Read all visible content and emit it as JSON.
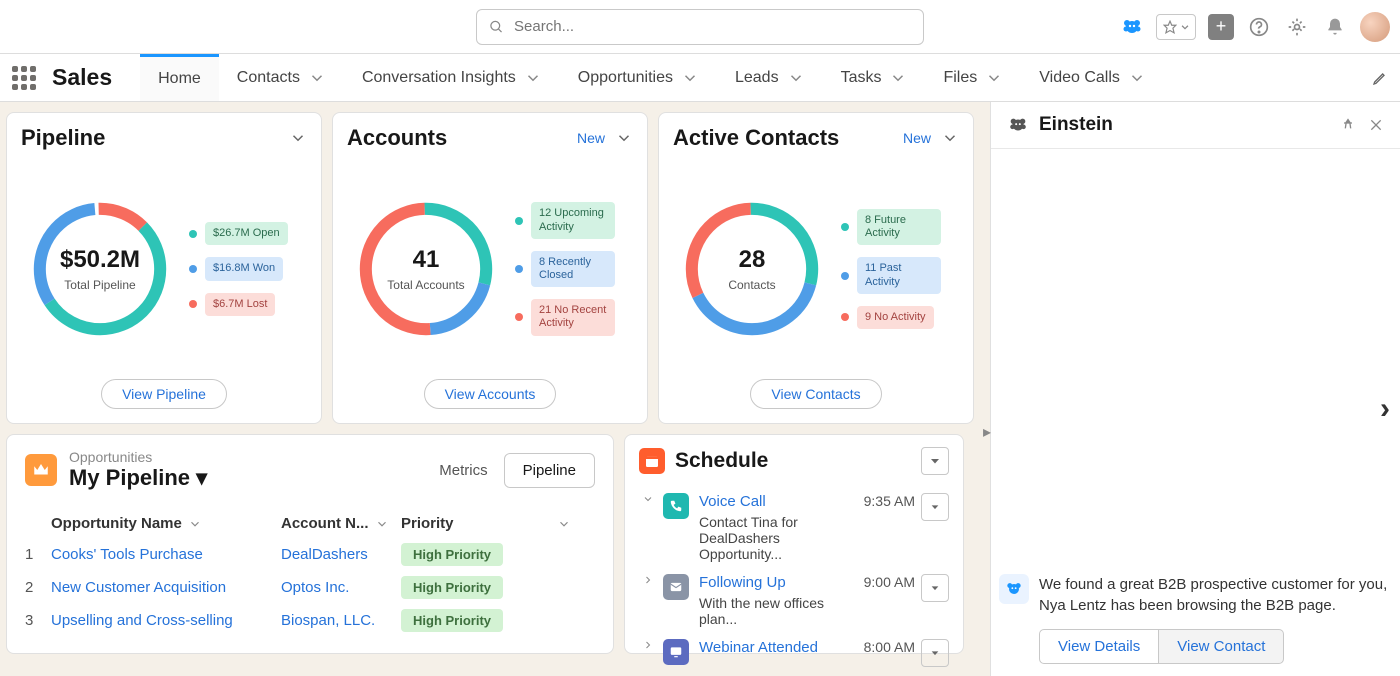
{
  "header": {
    "search_placeholder": "Search...",
    "app_title": "Sales"
  },
  "tabs": [
    "Home",
    "Contacts",
    "Conversation Insights",
    "Opportunities",
    "Leads",
    "Tasks",
    "Files",
    "Video Calls"
  ],
  "pipeline_card": {
    "title": "Pipeline",
    "center_value": "$50.2M",
    "center_label": "Total Pipeline",
    "legend": [
      {
        "text": "$26.7M Open",
        "color": "#2ec4b6"
      },
      {
        "text": "$16.8M Won",
        "color": "#4f9de7"
      },
      {
        "text": "$6.7M Lost",
        "color": "#f76c5e"
      }
    ],
    "view_btn": "View Pipeline"
  },
  "accounts_card": {
    "title": "Accounts",
    "action": "New",
    "center_value": "41",
    "center_label": "Total Accounts",
    "legend": [
      {
        "text": "12 Upcoming Activity",
        "color": "#2ec4b6"
      },
      {
        "text": "8 Recently Closed",
        "color": "#4f9de7"
      },
      {
        "text": "21 No Recent Activity",
        "color": "#f76c5e"
      }
    ],
    "view_btn": "View Accounts"
  },
  "contacts_card": {
    "title": "Active Contacts",
    "action": "New",
    "center_value": "28",
    "center_label": "Contacts",
    "legend": [
      {
        "text": "8 Future Activity",
        "color": "#2ec4b6"
      },
      {
        "text": "11 Past Activity",
        "color": "#4f9de7"
      },
      {
        "text": "9 No Activity",
        "color": "#f76c5e"
      }
    ],
    "view_btn": "View Contacts"
  },
  "opportunities": {
    "sub": "Opportunities",
    "main": "My Pipeline",
    "metrics_label": "Metrics",
    "pipeline_label": "Pipeline",
    "columns": {
      "name": "Opportunity Name",
      "acct": "Account N...",
      "prio": "Priority"
    },
    "rows": [
      {
        "idx": "1",
        "name": "Cooks' Tools Purchase",
        "acct": "DealDashers",
        "prio": "High Priority"
      },
      {
        "idx": "2",
        "name": "New Customer Acquisition",
        "acct": "Optos Inc.",
        "prio": "High Priority"
      },
      {
        "idx": "3",
        "name": "Upselling and Cross-selling",
        "acct": "Biospan, LLC.",
        "prio": "High Priority"
      }
    ]
  },
  "schedule": {
    "title": "Schedule",
    "items": [
      {
        "title": "Voice Call",
        "sub": "Contact Tina for DealDashers Opportunity...",
        "time": "9:35 AM",
        "type": "call",
        "expanded": true
      },
      {
        "title": "Following Up",
        "sub": "With the new offices plan...",
        "time": "9:00 AM",
        "type": "mail",
        "expanded": false
      },
      {
        "title": "Webinar Attended",
        "sub": "",
        "time": "8:00 AM",
        "type": "webinar",
        "expanded": false
      }
    ]
  },
  "einstein": {
    "title": "Einstein",
    "msg": "We found a great B2B prospective customer for you, Nya Lentz has been browsing the B2B page.",
    "btn_details": "View Details",
    "btn_contact": "View Contact"
  },
  "chart_data": [
    {
      "type": "pie",
      "title": "Pipeline",
      "series": [
        {
          "name": "Open",
          "value": 26.7
        },
        {
          "name": "Won",
          "value": 16.8
        },
        {
          "name": "Lost",
          "value": 6.7
        }
      ],
      "unit": "$M",
      "total": "$50.2M"
    },
    {
      "type": "pie",
      "title": "Accounts",
      "series": [
        {
          "name": "Upcoming Activity",
          "value": 12
        },
        {
          "name": "Recently Closed",
          "value": 8
        },
        {
          "name": "No Recent Activity",
          "value": 21
        }
      ],
      "total": 41
    },
    {
      "type": "pie",
      "title": "Active Contacts",
      "series": [
        {
          "name": "Future Activity",
          "value": 8
        },
        {
          "name": "Past Activity",
          "value": 11
        },
        {
          "name": "No Activity",
          "value": 9
        }
      ],
      "total": 28
    }
  ]
}
